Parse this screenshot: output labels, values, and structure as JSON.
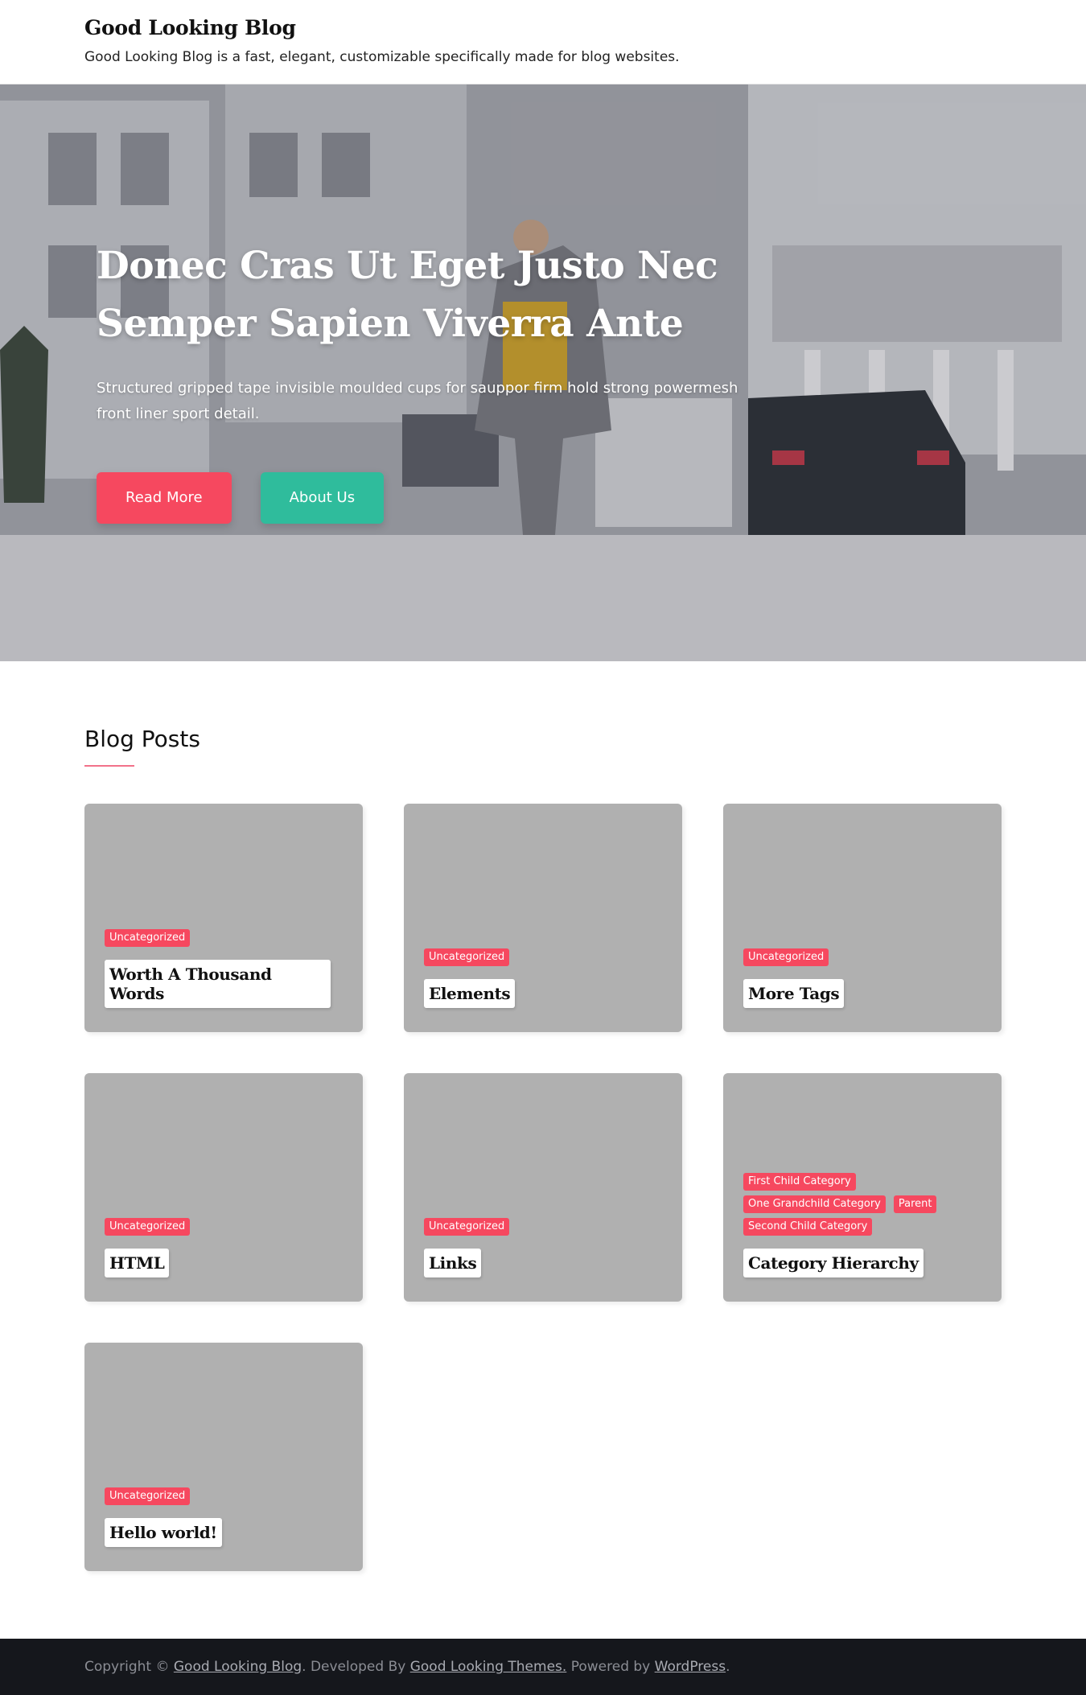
{
  "header": {
    "site_title": "Good Looking Blog",
    "site_description": "Good Looking Blog is a fast, elegant, customizable specifically made for blog websites."
  },
  "hero": {
    "title": "Donec Cras Ut Eget Justo Nec Semper Sapien Viverra Ante",
    "text": "Structured gripped tape invisible moulded cups for sauppor firm hold strong powermesh front liner sport detail.",
    "primary_button": "Read More",
    "secondary_button": "About Us"
  },
  "blog": {
    "section_title": "Blog Posts",
    "posts": [
      {
        "categories": [
          "Uncategorized"
        ],
        "title": "Worth A Thousand Words"
      },
      {
        "categories": [
          "Uncategorized"
        ],
        "title": "Elements"
      },
      {
        "categories": [
          "Uncategorized"
        ],
        "title": "More Tags"
      },
      {
        "categories": [
          "Uncategorized"
        ],
        "title": "HTML"
      },
      {
        "categories": [
          "Uncategorized"
        ],
        "title": "Links"
      },
      {
        "categories": [
          "First Child Category",
          "One Grandchild Category",
          "Parent",
          "Second Child Category"
        ],
        "title": "Category Hierarchy"
      },
      {
        "categories": [
          "Uncategorized"
        ],
        "title": "Hello world!"
      }
    ]
  },
  "footer": {
    "copyright_prefix": "Copyright © ",
    "site_link": "Good Looking Blog",
    "developed_by": ". Developed By ",
    "themes_link": "Good Looking Themes.",
    "powered_by": " Powered by ",
    "wordpress_link": "WordPress",
    "suffix": "."
  },
  "colors": {
    "accent_pink": "#f6485f",
    "accent_teal": "#2fbc9c",
    "card_bg": "#b0b0b0",
    "footer_bg": "#15171c"
  }
}
